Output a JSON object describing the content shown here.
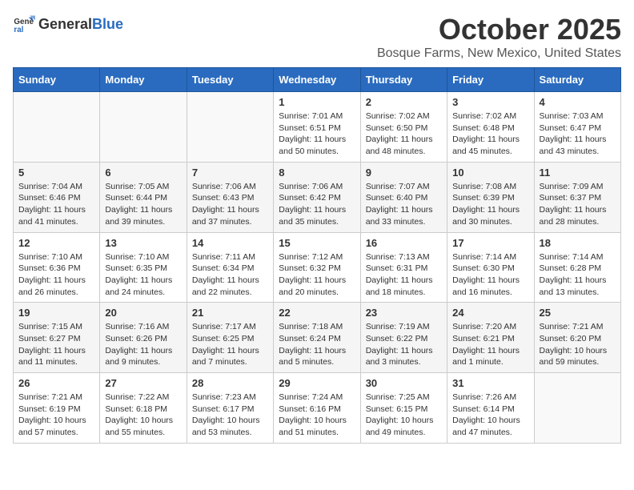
{
  "header": {
    "logo_general": "General",
    "logo_blue": "Blue",
    "month": "October 2025",
    "location": "Bosque Farms, New Mexico, United States"
  },
  "days_of_week": [
    "Sunday",
    "Monday",
    "Tuesday",
    "Wednesday",
    "Thursday",
    "Friday",
    "Saturday"
  ],
  "weeks": [
    [
      {
        "day": "",
        "info": ""
      },
      {
        "day": "",
        "info": ""
      },
      {
        "day": "",
        "info": ""
      },
      {
        "day": "1",
        "info": "Sunrise: 7:01 AM\nSunset: 6:51 PM\nDaylight: 11 hours\nand 50 minutes."
      },
      {
        "day": "2",
        "info": "Sunrise: 7:02 AM\nSunset: 6:50 PM\nDaylight: 11 hours\nand 48 minutes."
      },
      {
        "day": "3",
        "info": "Sunrise: 7:02 AM\nSunset: 6:48 PM\nDaylight: 11 hours\nand 45 minutes."
      },
      {
        "day": "4",
        "info": "Sunrise: 7:03 AM\nSunset: 6:47 PM\nDaylight: 11 hours\nand 43 minutes."
      }
    ],
    [
      {
        "day": "5",
        "info": "Sunrise: 7:04 AM\nSunset: 6:46 PM\nDaylight: 11 hours\nand 41 minutes."
      },
      {
        "day": "6",
        "info": "Sunrise: 7:05 AM\nSunset: 6:44 PM\nDaylight: 11 hours\nand 39 minutes."
      },
      {
        "day": "7",
        "info": "Sunrise: 7:06 AM\nSunset: 6:43 PM\nDaylight: 11 hours\nand 37 minutes."
      },
      {
        "day": "8",
        "info": "Sunrise: 7:06 AM\nSunset: 6:42 PM\nDaylight: 11 hours\nand 35 minutes."
      },
      {
        "day": "9",
        "info": "Sunrise: 7:07 AM\nSunset: 6:40 PM\nDaylight: 11 hours\nand 33 minutes."
      },
      {
        "day": "10",
        "info": "Sunrise: 7:08 AM\nSunset: 6:39 PM\nDaylight: 11 hours\nand 30 minutes."
      },
      {
        "day": "11",
        "info": "Sunrise: 7:09 AM\nSunset: 6:37 PM\nDaylight: 11 hours\nand 28 minutes."
      }
    ],
    [
      {
        "day": "12",
        "info": "Sunrise: 7:10 AM\nSunset: 6:36 PM\nDaylight: 11 hours\nand 26 minutes."
      },
      {
        "day": "13",
        "info": "Sunrise: 7:10 AM\nSunset: 6:35 PM\nDaylight: 11 hours\nand 24 minutes."
      },
      {
        "day": "14",
        "info": "Sunrise: 7:11 AM\nSunset: 6:34 PM\nDaylight: 11 hours\nand 22 minutes."
      },
      {
        "day": "15",
        "info": "Sunrise: 7:12 AM\nSunset: 6:32 PM\nDaylight: 11 hours\nand 20 minutes."
      },
      {
        "day": "16",
        "info": "Sunrise: 7:13 AM\nSunset: 6:31 PM\nDaylight: 11 hours\nand 18 minutes."
      },
      {
        "day": "17",
        "info": "Sunrise: 7:14 AM\nSunset: 6:30 PM\nDaylight: 11 hours\nand 16 minutes."
      },
      {
        "day": "18",
        "info": "Sunrise: 7:14 AM\nSunset: 6:28 PM\nDaylight: 11 hours\nand 13 minutes."
      }
    ],
    [
      {
        "day": "19",
        "info": "Sunrise: 7:15 AM\nSunset: 6:27 PM\nDaylight: 11 hours\nand 11 minutes."
      },
      {
        "day": "20",
        "info": "Sunrise: 7:16 AM\nSunset: 6:26 PM\nDaylight: 11 hours\nand 9 minutes."
      },
      {
        "day": "21",
        "info": "Sunrise: 7:17 AM\nSunset: 6:25 PM\nDaylight: 11 hours\nand 7 minutes."
      },
      {
        "day": "22",
        "info": "Sunrise: 7:18 AM\nSunset: 6:24 PM\nDaylight: 11 hours\nand 5 minutes."
      },
      {
        "day": "23",
        "info": "Sunrise: 7:19 AM\nSunset: 6:22 PM\nDaylight: 11 hours\nand 3 minutes."
      },
      {
        "day": "24",
        "info": "Sunrise: 7:20 AM\nSunset: 6:21 PM\nDaylight: 11 hours\nand 1 minute."
      },
      {
        "day": "25",
        "info": "Sunrise: 7:21 AM\nSunset: 6:20 PM\nDaylight: 10 hours\nand 59 minutes."
      }
    ],
    [
      {
        "day": "26",
        "info": "Sunrise: 7:21 AM\nSunset: 6:19 PM\nDaylight: 10 hours\nand 57 minutes."
      },
      {
        "day": "27",
        "info": "Sunrise: 7:22 AM\nSunset: 6:18 PM\nDaylight: 10 hours\nand 55 minutes."
      },
      {
        "day": "28",
        "info": "Sunrise: 7:23 AM\nSunset: 6:17 PM\nDaylight: 10 hours\nand 53 minutes."
      },
      {
        "day": "29",
        "info": "Sunrise: 7:24 AM\nSunset: 6:16 PM\nDaylight: 10 hours\nand 51 minutes."
      },
      {
        "day": "30",
        "info": "Sunrise: 7:25 AM\nSunset: 6:15 PM\nDaylight: 10 hours\nand 49 minutes."
      },
      {
        "day": "31",
        "info": "Sunrise: 7:26 AM\nSunset: 6:14 PM\nDaylight: 10 hours\nand 47 minutes."
      },
      {
        "day": "",
        "info": ""
      }
    ]
  ]
}
